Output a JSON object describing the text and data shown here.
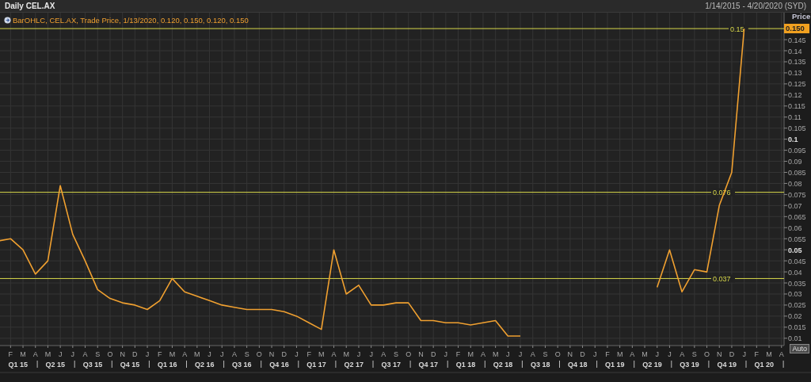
{
  "header": {
    "title": "Daily CEL.AX",
    "range": "1/14/2015 - 4/20/2020 (SYD)"
  },
  "chart": {
    "legend": "BarOHLC, CEL.AX, Trade Price, 1/13/2020, 0.120, 0.150, 0.120, 0.150",
    "axis_title": "Price",
    "last_price": "0.150",
    "auto_button": "Auto",
    "quarters": [
      "Q1 15",
      "Q2 15",
      "Q3 15",
      "Q4 15",
      "Q1 16",
      "Q2 16",
      "Q3 16",
      "Q4 16",
      "Q1 17",
      "Q2 17",
      "Q3 17",
      "Q4 17",
      "Q1 18",
      "Q2 18",
      "Q3 18",
      "Q4 18",
      "Q1 19",
      "Q2 19",
      "Q3 19",
      "Q4 19",
      "Q1 20"
    ],
    "chart_data": {
      "type": "line",
      "grid": true,
      "ylim": [
        0.0067,
        0.1572
      ],
      "categories": [
        null,
        "F",
        "M",
        "A",
        "M",
        "J",
        "J",
        "A",
        "S",
        "O",
        "N",
        "D",
        "J",
        "F",
        "M",
        "A",
        "M",
        "J",
        "J",
        "A",
        "S",
        "O",
        "N",
        "D",
        "J",
        "F",
        "M",
        "A",
        "M",
        "J",
        "J",
        "A",
        "S",
        "O",
        "N",
        "D",
        "J",
        "F",
        "M",
        "A",
        "M",
        "J",
        "J",
        "A",
        "S",
        "O",
        "N",
        "D",
        "J",
        "F",
        "M",
        "A",
        "M",
        "J",
        "J",
        "A",
        "S",
        "O",
        "N",
        "D",
        "J",
        "F",
        "M",
        "A"
      ],
      "series": [
        {
          "color": "#f0a030",
          "values": [
            0.054,
            0.055,
            0.05,
            0.039,
            0.045,
            0.079,
            0.057,
            0.045,
            0.032,
            0.028,
            0.026,
            0.025,
            0.023,
            0.027,
            0.037,
            0.031,
            0.029,
            0.027,
            0.025,
            0.024,
            0.023,
            0.023,
            0.023,
            0.022,
            0.02,
            0.017,
            0.014,
            0.05,
            0.03,
            0.034,
            0.025,
            0.025,
            0.026,
            0.026,
            0.018,
            0.018,
            0.017,
            0.017,
            0.016,
            0.017,
            0.018,
            0.011,
            0.011,
            null,
            null,
            null,
            null,
            null,
            null,
            null,
            null,
            null,
            null,
            0.033,
            0.05,
            0.031,
            0.041,
            0.04,
            0.07,
            0.085,
            0.15,
            null,
            null,
            null
          ]
        }
      ],
      "yticks": [
        0.01,
        0.015,
        0.02,
        0.025,
        0.03,
        0.035,
        0.04,
        0.045,
        0.05,
        0.055,
        0.06,
        0.065,
        0.07,
        0.075,
        0.08,
        0.085,
        0.09,
        0.095,
        0.1,
        0.105,
        0.11,
        0.115,
        0.12,
        0.125,
        0.13,
        0.135,
        0.14,
        0.145
      ],
      "ref_lines": [
        {
          "axis": "y",
          "value": 0.15,
          "label": "0.15",
          "color": "#d8d84a"
        },
        {
          "axis": "y",
          "value": 0.076,
          "label": "0.076",
          "color": "#d8d84a"
        },
        {
          "axis": "y",
          "value": 0.037,
          "label": "0.037",
          "color": "#d8d84a"
        }
      ]
    }
  }
}
